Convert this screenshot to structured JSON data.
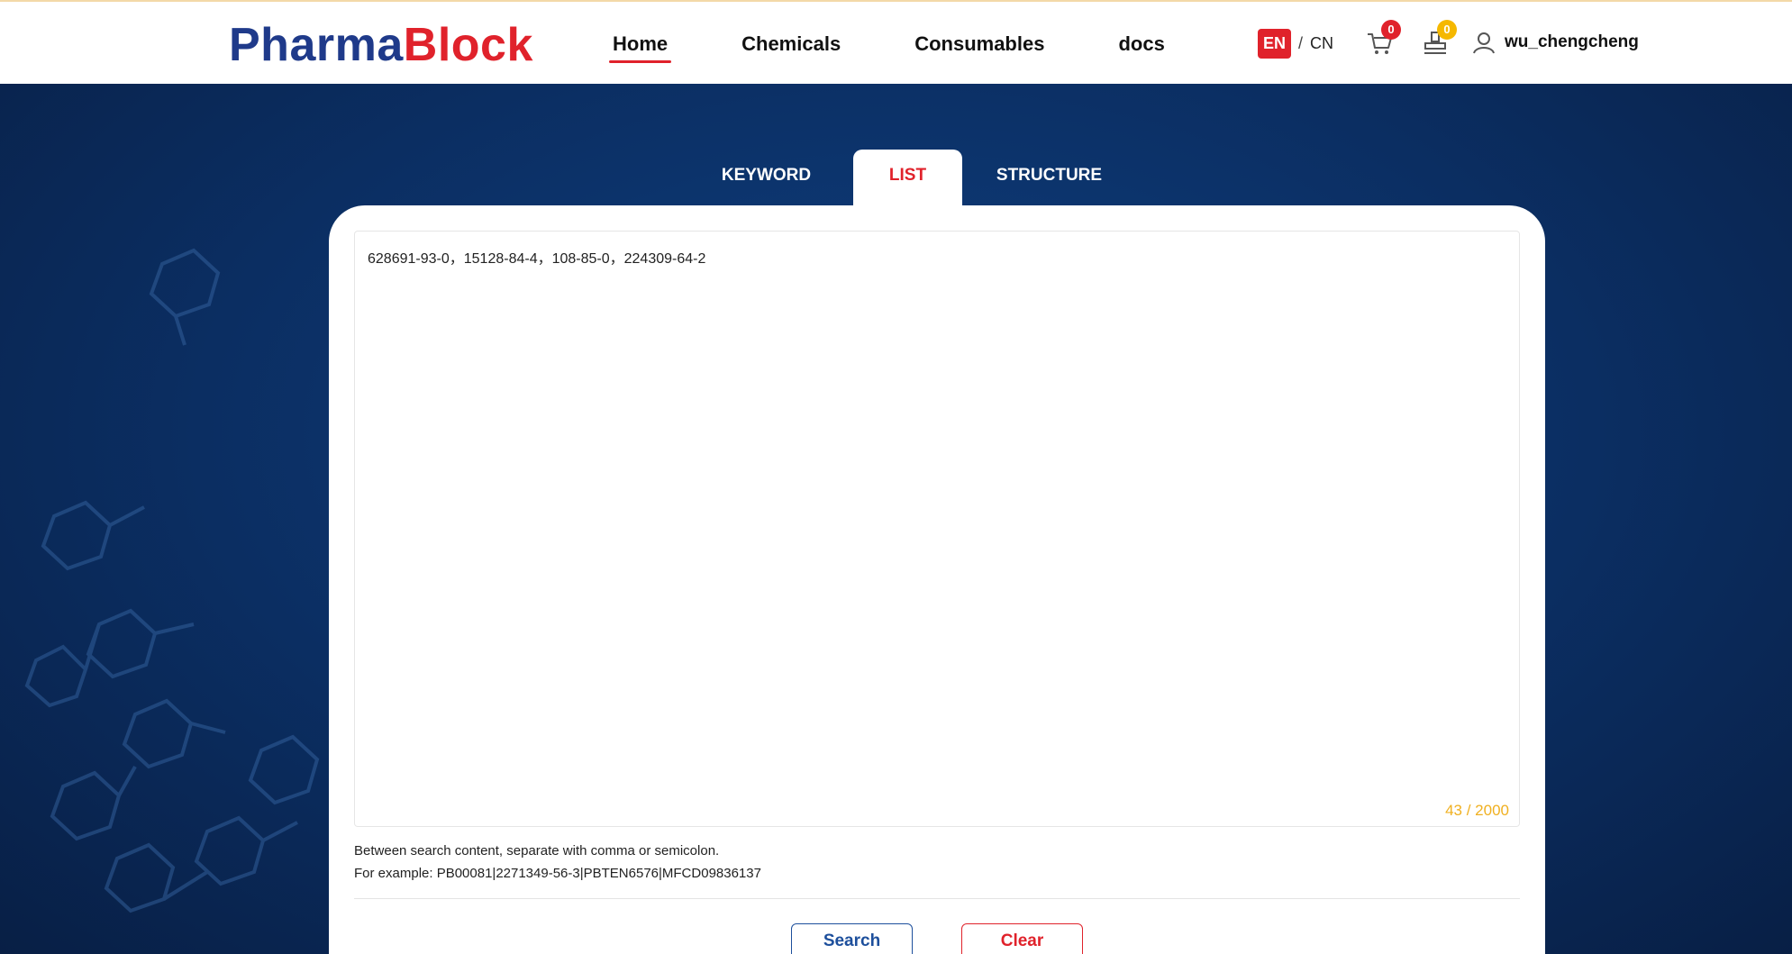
{
  "brand": {
    "part1": "Pharma",
    "part2": "Block"
  },
  "nav": {
    "home": "Home",
    "chemicals": "Chemicals",
    "consumables": "Consumables",
    "docs": "docs"
  },
  "lang": {
    "en": "EN",
    "sep": "/",
    "cn": "CN"
  },
  "cart": {
    "count": "0"
  },
  "inquiry": {
    "count": "0"
  },
  "user": {
    "name": "wu_chengcheng"
  },
  "tabs": {
    "keyword": "KEYWORD",
    "list": "LIST",
    "structure": "STRUCTURE"
  },
  "search_list": {
    "value": "628691-93-0，15128-84-4，108-85-0，224309-64-2",
    "counter": "43 / 2000",
    "hint_line1": "Between search content, separate with comma or semicolon.",
    "hint_line2": "For example: PB00081|2271349-56-3|PBTEN6576|MFCD09836137"
  },
  "buttons": {
    "search": "Search",
    "clear": "Clear"
  },
  "colors": {
    "brand_blue": "#1f3a8a",
    "brand_red": "#e0222b",
    "badge_yellow": "#f5b800",
    "counter": "#f0b020"
  }
}
